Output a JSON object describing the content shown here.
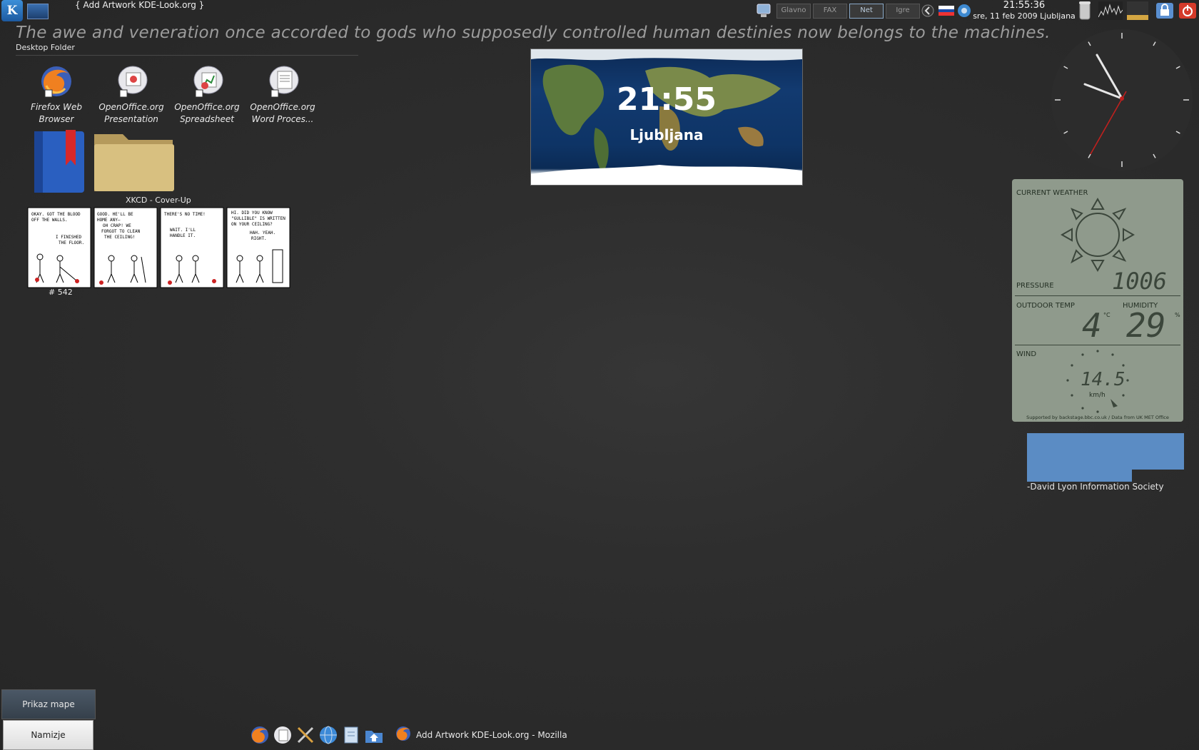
{
  "top_panel": {
    "active_window_title": "{ Add Artwork KDE-Look.org }",
    "pager": [
      "Glavno",
      "FAX",
      "Net",
      "Igre"
    ],
    "pager_active": "Net",
    "clock_time": "21:55:36",
    "clock_date": "sre, 11 feb 2009 Ljubljana",
    "tray_icons": [
      "monitor-icon",
      "back-arrow-icon",
      "keyboard-layout-icon",
      "network-icon",
      "trash-icon",
      "cpu-graph-icon",
      "battery-icon",
      "lock-icon",
      "power-icon"
    ]
  },
  "quote": {
    "text": "The awe and veneration once accorded to gods who supposedly controlled human destinies now belongs to the machines.",
    "author": "-David Lyon Information Society"
  },
  "desktop_folder": {
    "title": "Desktop Folder",
    "icons": [
      {
        "line1": "Firefox Web",
        "line2": "Browser",
        "icon": "firefox-icon"
      },
      {
        "line1": "OpenOffice.org",
        "line2": "Presentation",
        "icon": "oo-presentation-icon"
      },
      {
        "line1": "OpenOffice.org",
        "line2": "Spreadsheet",
        "icon": "oo-spreadsheet-icon"
      },
      {
        "line1": "OpenOffice.org",
        "line2": "Word Proces...",
        "icon": "oo-writer-icon"
      }
    ]
  },
  "world_clock": {
    "time": "21:55",
    "city": "Ljubljana"
  },
  "comic": {
    "title": "XKCD - Cover-Up",
    "number": "# 542"
  },
  "weather": {
    "current_label": "CURRENT WEATHER",
    "pressure_label": "PRESSURE",
    "pressure": "1006",
    "outdoor_label": "OUTDOOR TEMP",
    "temp": "4",
    "temp_unit": "°C",
    "humidity_label": "HUMIDITY",
    "humidity": "29",
    "humidity_unit": "%",
    "wind_label": "WIND",
    "wind": "14.5",
    "wind_unit": "km/h",
    "credit": "Supported by backstage.bbc.co.uk / Data from UK MET Office"
  },
  "bottom_left": {
    "map_button": "Prikaz mape",
    "settings_button": "Namizje"
  },
  "taskbar": {
    "task_title": "Add Artwork KDE-Look.org - Mozilla"
  },
  "colors": {
    "map_ocean": "#123a70",
    "weather_bg": "#8f9a8c",
    "quote_box": "#5b8cc4"
  }
}
